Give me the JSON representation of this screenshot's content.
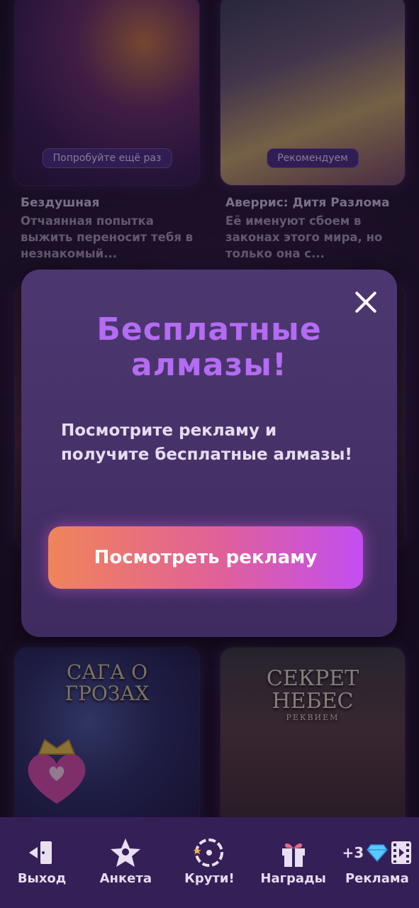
{
  "stories": [
    {
      "title": "Бездушная",
      "desc": "Отчаянная попытка выжить переносит тебя в незнакомый...",
      "badge": "Попробуйте ещё раз"
    },
    {
      "title": "Аверрис: Дитя Разлома",
      "desc": "Её именуют сбоем в законах этого мира, но только она с...",
      "badge": "Рекомендуем"
    }
  ],
  "covers": {
    "saga": "САГА О ГРОЗАХ",
    "secret_line1": "СЕКРЕТ",
    "secret_line2": "НЕБЕС",
    "secret_sub": "РЕКВИЕМ"
  },
  "modal": {
    "title": "Бесплатные алмазы!",
    "body": "Посмотрите рекламу и получите бесплатные алмазы!",
    "cta": "Посмотреть рекламу"
  },
  "nav": {
    "exit": "Выход",
    "profile": "Анкета",
    "spin": "Крути!",
    "rewards": "Награды",
    "ads": "Реклама",
    "ads_bonus": "+3"
  },
  "colors": {
    "accent_title": "#b36cf2",
    "modal_bg": "#4d3770",
    "nav_bg": "#351f57"
  }
}
